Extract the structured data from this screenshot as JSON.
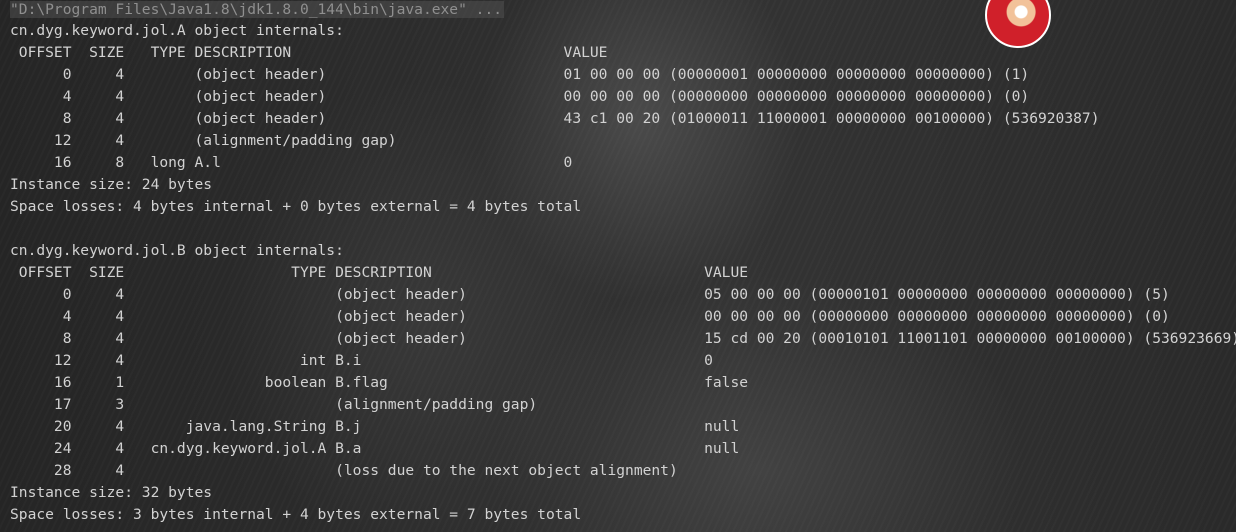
{
  "console": {
    "command_line": "\"D:\\Program Files\\Java1.8\\jdk1.8.0_144\\bin\\java.exe\" ...",
    "lines": [
      "cn.dyg.keyword.jol.A object internals:",
      " OFFSET  SIZE   TYPE DESCRIPTION                               VALUE",
      "      0     4        (object header)                           01 00 00 00 (00000001 00000000 00000000 00000000) (1)",
      "      4     4        (object header)                           00 00 00 00 (00000000 00000000 00000000 00000000) (0)",
      "      8     4        (object header)                           43 c1 00 20 (01000011 11000001 00000000 00100000) (536920387)",
      "     12     4        (alignment/padding gap)",
      "     16     8   long A.l                                       0",
      "Instance size: 24 bytes",
      "Space losses: 4 bytes internal + 0 bytes external = 4 bytes total",
      "",
      "cn.dyg.keyword.jol.B object internals:",
      " OFFSET  SIZE                   TYPE DESCRIPTION                               VALUE",
      "      0     4                        (object header)                           05 00 00 00 (00000101 00000000 00000000 00000000) (5)",
      "      4     4                        (object header)                           00 00 00 00 (00000000 00000000 00000000 00000000) (0)",
      "      8     4                        (object header)                           15 cd 00 20 (00010101 11001101 00000000 00100000) (536923669)",
      "     12     4                    int B.i                                       0",
      "     16     1                boolean B.flag                                    false",
      "     17     3                        (alignment/padding gap)",
      "     20     4       java.lang.String B.j                                       null",
      "     24     4   cn.dyg.keyword.jol.A B.a                                       null",
      "     28     4                        (loss due to the next object alignment)",
      "Instance size: 32 bytes",
      "Space losses: 3 bytes internal + 4 bytes external = 7 bytes total"
    ]
  }
}
